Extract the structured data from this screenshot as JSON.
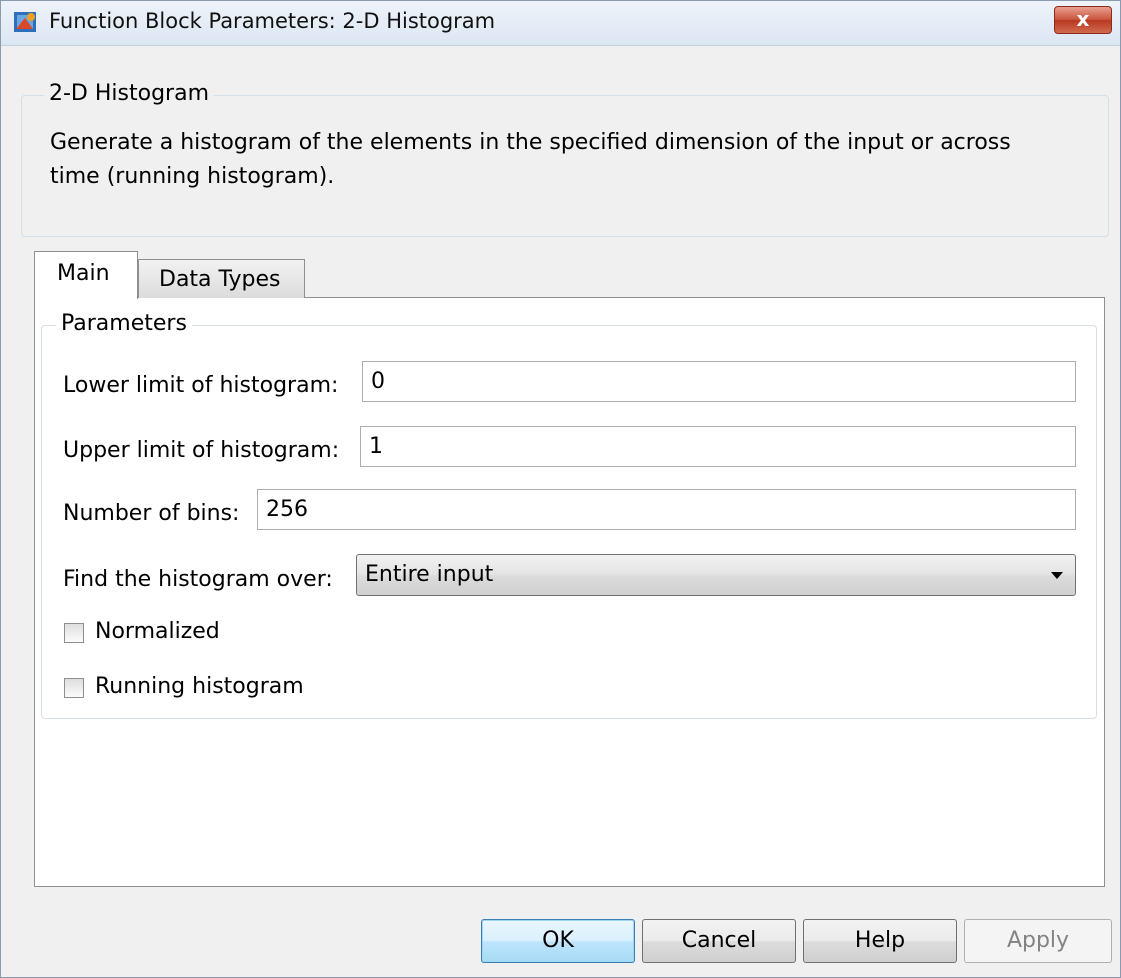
{
  "window": {
    "title": "Function Block Parameters: 2-D Histogram",
    "close_label": "x"
  },
  "block": {
    "name": "2-D Histogram",
    "description": "Generate a histogram of the elements in the specified dimension of the input or across time (running histogram)."
  },
  "tabs": [
    {
      "label": "Main",
      "selected": true
    },
    {
      "label": "Data Types",
      "selected": false
    }
  ],
  "parameters": {
    "group_title": "Parameters",
    "lower_limit": {
      "label": "Lower limit of histogram:",
      "value": "0"
    },
    "upper_limit": {
      "label": "Upper limit of histogram:",
      "value": "1"
    },
    "num_bins": {
      "label": "Number of bins:",
      "value": "256"
    },
    "find_over": {
      "label": "Find the histogram over:",
      "value": "Entire input"
    },
    "normalized": {
      "label": "Normalized",
      "checked": false
    },
    "running": {
      "label": "Running histogram",
      "checked": false
    }
  },
  "buttons": {
    "ok": "OK",
    "cancel": "Cancel",
    "help": "Help",
    "apply": "Apply"
  }
}
